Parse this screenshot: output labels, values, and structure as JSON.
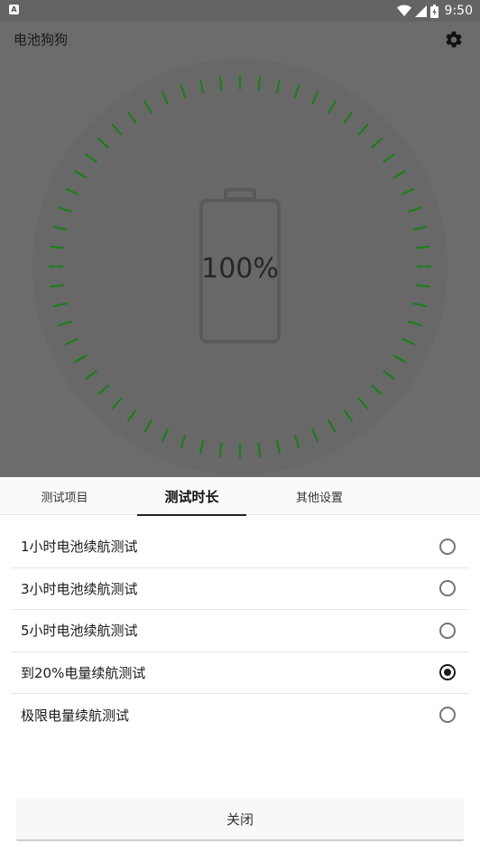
{
  "status_bar": {
    "time": "9:50",
    "left_icon_glyph": "A",
    "icons": [
      "wifi-icon",
      "cell-signal-icon",
      "battery-icon"
    ]
  },
  "app": {
    "title": "电池狗狗",
    "settings_icon": "gear-icon"
  },
  "gauge": {
    "percent_text": "100%",
    "level": 1.0,
    "tick_count": 60,
    "tick_color": "#1e7d1e"
  },
  "tabs": [
    {
      "label": "测试项目",
      "active": false
    },
    {
      "label": "测试时长",
      "active": true
    },
    {
      "label": "其他设置",
      "active": false
    }
  ],
  "options": [
    {
      "label": "1小时电池续航测试",
      "selected": false
    },
    {
      "label": "3小时电池续航测试",
      "selected": false
    },
    {
      "label": "5小时电池续航测试",
      "selected": false
    },
    {
      "label": "到20%电量续航测试",
      "selected": true
    },
    {
      "label": "极限电量续航测试",
      "selected": false
    }
  ],
  "close_button": {
    "label": "关闭"
  },
  "colors": {
    "overlay": "#6c6c6c",
    "tick": "#1e7d1e",
    "sheet_bg": "#ffffff"
  }
}
